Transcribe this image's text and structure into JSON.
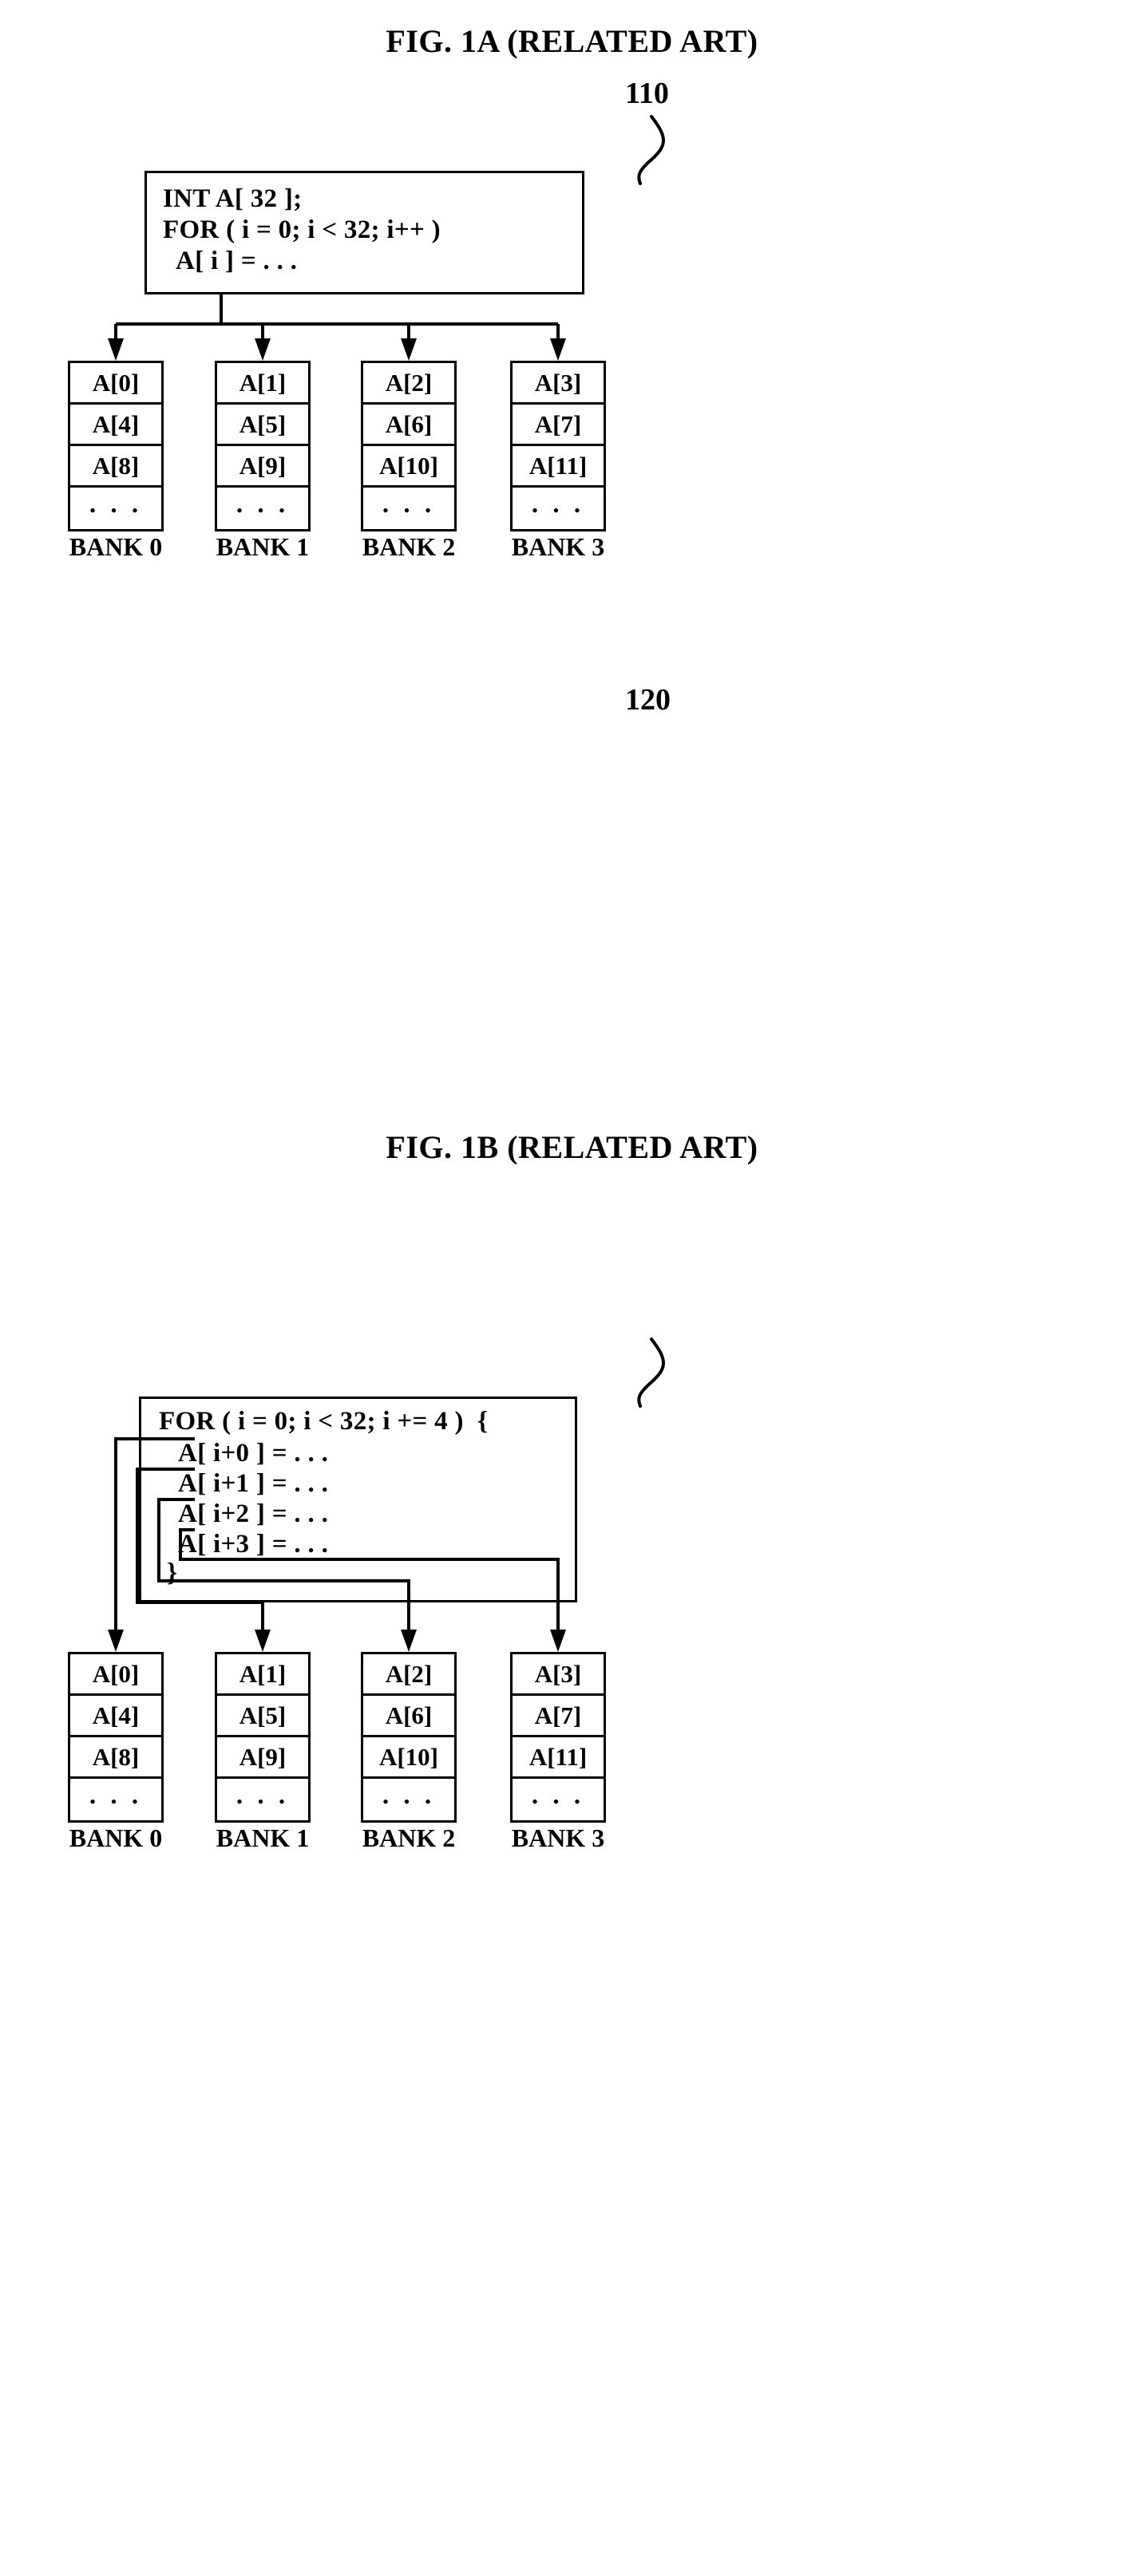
{
  "figures": [
    {
      "title": "FIG. 1A (RELATED ART)",
      "ref_numeral": "110",
      "code_lines": [
        "INT A[ 32 ];",
        "FOR ( i = 0; i < 32; i++ )",
        "A[ i ] = . . ."
      ],
      "banks": [
        {
          "label": "BANK 0",
          "cells": [
            "A[0]",
            "A[4]",
            "A[8]",
            ". . ."
          ]
        },
        {
          "label": "BANK 1",
          "cells": [
            "A[1]",
            "A[5]",
            "A[9]",
            ". . ."
          ]
        },
        {
          "label": "BANK 2",
          "cells": [
            "A[2]",
            "A[6]",
            "A[10]",
            ". . ."
          ]
        },
        {
          "label": "BANK 3",
          "cells": [
            "A[3]",
            "A[7]",
            "A[11]",
            ". . ."
          ]
        }
      ]
    },
    {
      "title": "FIG. 1B (RELATED ART)",
      "ref_numeral": "120",
      "code_lines": [
        "FOR ( i = 0; i < 32; i += 4 )  {",
        "A[ i+0 ] = . . .",
        "A[ i+1 ] = . . .",
        "A[ i+2 ] = . . .",
        "A[ i+3 ] = . . .",
        "}"
      ],
      "banks": [
        {
          "label": "BANK 0",
          "cells": [
            "A[0]",
            "A[4]",
            "A[8]",
            ". . ."
          ]
        },
        {
          "label": "BANK 1",
          "cells": [
            "A[1]",
            "A[5]",
            "A[9]",
            ". . ."
          ]
        },
        {
          "label": "BANK 2",
          "cells": [
            "A[2]",
            "A[6]",
            "A[10]",
            ". . ."
          ]
        },
        {
          "label": "BANK 3",
          "cells": [
            "A[3]",
            "A[7]",
            "A[11]",
            ". . ."
          ]
        }
      ]
    }
  ],
  "colors": {
    "ink": "#000000",
    "paper": "#ffffff"
  }
}
